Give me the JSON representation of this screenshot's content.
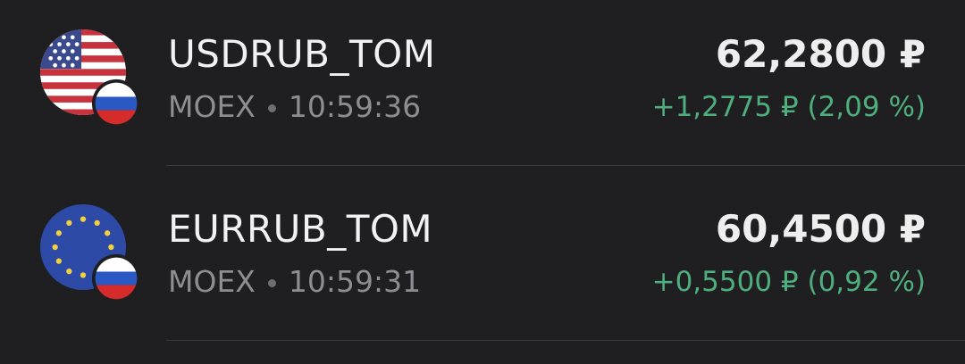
{
  "instruments": [
    {
      "ticker": "USDRUB_TOM",
      "exchange": "MOEX",
      "time": "10:59:36",
      "price": "62,2800 ₽",
      "change": "+1,2775 ₽ (2,09 %)",
      "base_flag": "us-flag-icon",
      "quote_flag": "ru-flag-icon"
    },
    {
      "ticker": "EURRUB_TOM",
      "exchange": "MOEX",
      "time": "10:59:31",
      "price": "60,4500 ₽",
      "change": "+0,5500 ₽ (0,92 %)",
      "base_flag": "eu-flag-icon",
      "quote_flag": "ru-flag-icon"
    }
  ],
  "colors": {
    "background": "#1f1f21",
    "positive": "#4fae7d",
    "primary_text": "#f2f2f2",
    "secondary_text": "#8d8d92"
  }
}
